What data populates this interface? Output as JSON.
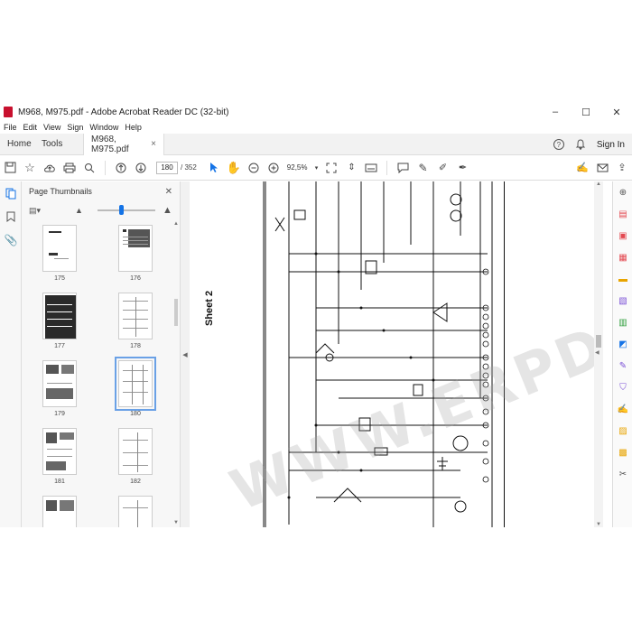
{
  "window": {
    "title": "M968, M975.pdf - Adobe Acrobat Reader DC (32-bit)",
    "minimize": "–",
    "maximize": "☐",
    "close": "✕"
  },
  "menu": [
    "File",
    "Edit",
    "View",
    "Sign",
    "Window",
    "Help"
  ],
  "tabs": {
    "home": "Home",
    "tools": "Tools",
    "document": "M968, M975.pdf",
    "close": "×"
  },
  "header_right": {
    "help": "?",
    "bell": "🔔",
    "signin": "Sign In"
  },
  "toolbar": {
    "page_current": "180",
    "page_total": "/ 352",
    "zoom": "92,5%"
  },
  "thumbnails_panel": {
    "title": "Page Thumbnails",
    "close": "✕",
    "pages": [
      {
        "label": "175"
      },
      {
        "label": "176"
      },
      {
        "label": "177"
      },
      {
        "label": "178"
      },
      {
        "label": "179"
      },
      {
        "label": "180",
        "selected": true
      },
      {
        "label": "181"
      },
      {
        "label": "182"
      }
    ]
  },
  "document": {
    "sheet_label": "Sheet 2",
    "watermark": "WWW.ERPDEPO.COM"
  }
}
